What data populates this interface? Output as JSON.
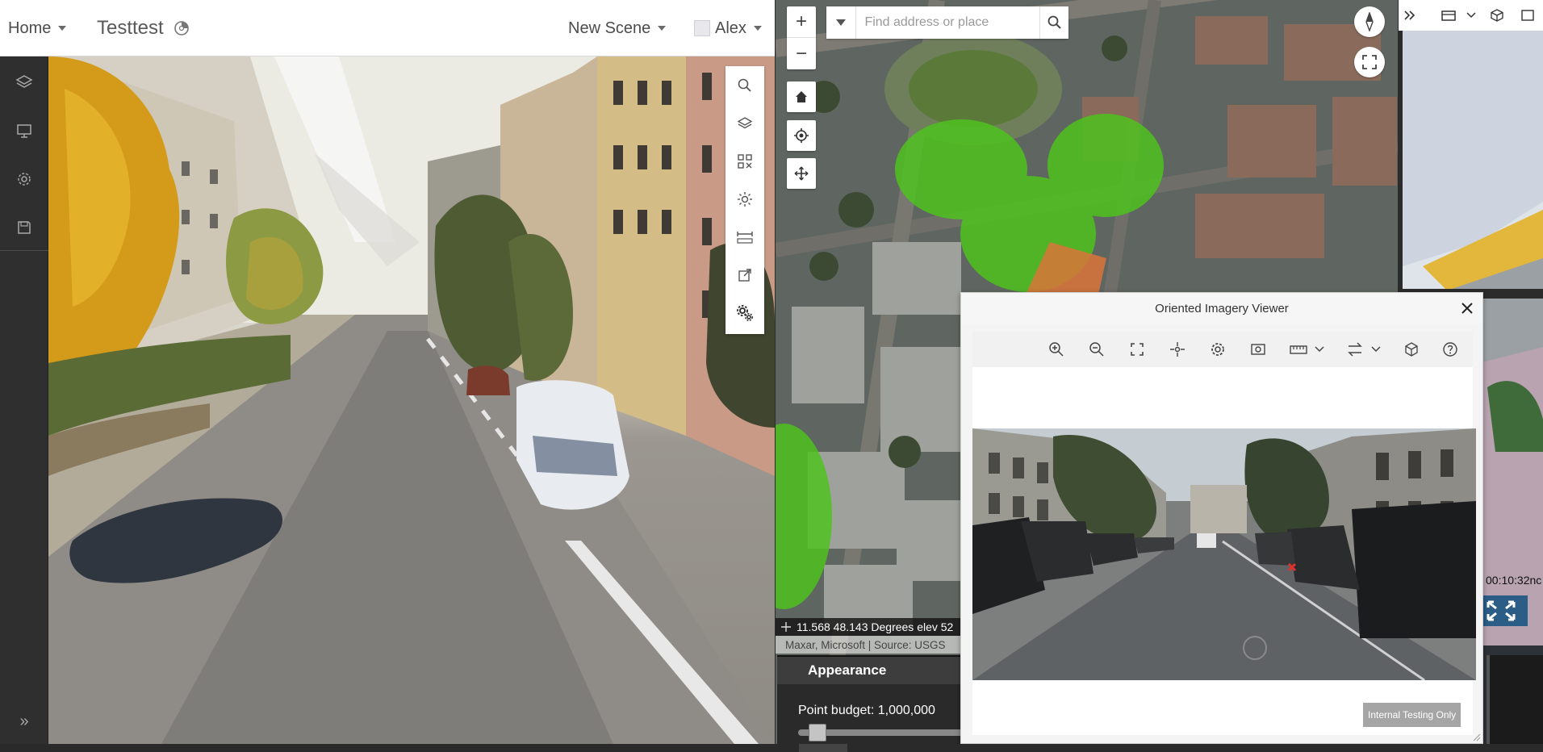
{
  "header": {
    "home_label": "Home",
    "app_title": "Testtest",
    "new_scene_label": "New Scene",
    "user_name": "Alex"
  },
  "side_nav": {
    "items": [
      {
        "icon": "layers-icon"
      },
      {
        "icon": "presentation-icon"
      },
      {
        "icon": "gear-icon"
      },
      {
        "icon": "save-icon"
      }
    ],
    "expand_glyph": "»"
  },
  "scene_tools": {
    "items": [
      "search-icon",
      "layers-icon",
      "qr-grid-icon",
      "sun-icon",
      "measure-icon",
      "share-icon",
      "settings-gears-icon"
    ]
  },
  "map": {
    "zoom_in": "+",
    "zoom_out": "−",
    "search_placeholder": "Find address or place",
    "coordinates_text": "11.568 48.143 Degrees   elev 52",
    "attribution": "Maxar, Microsoft | Source: USGS",
    "appearance_title": "Appearance",
    "point_budget_text": "Point budget: 1,000,000",
    "point_budget_fraction": 0.05
  },
  "right_pane": {
    "caption": "00:10:32nc"
  },
  "oi_dialog": {
    "title": "Oriented Imagery Viewer",
    "watermark": "Internal Testing Only",
    "tools": [
      "zoom-in-icon",
      "zoom-out-icon",
      "full-extent-icon",
      "pan-icon",
      "settings-icon",
      "image-enhance-icon",
      "measure-icon",
      "chevron-down-icon",
      "swap-icon",
      "chevron-down-icon",
      "cube-icon",
      "help-icon"
    ]
  },
  "colors": {
    "coverage_green": "#4fc21e",
    "view_cone": "#d9743a",
    "accent_blue": "#2b5d87"
  }
}
